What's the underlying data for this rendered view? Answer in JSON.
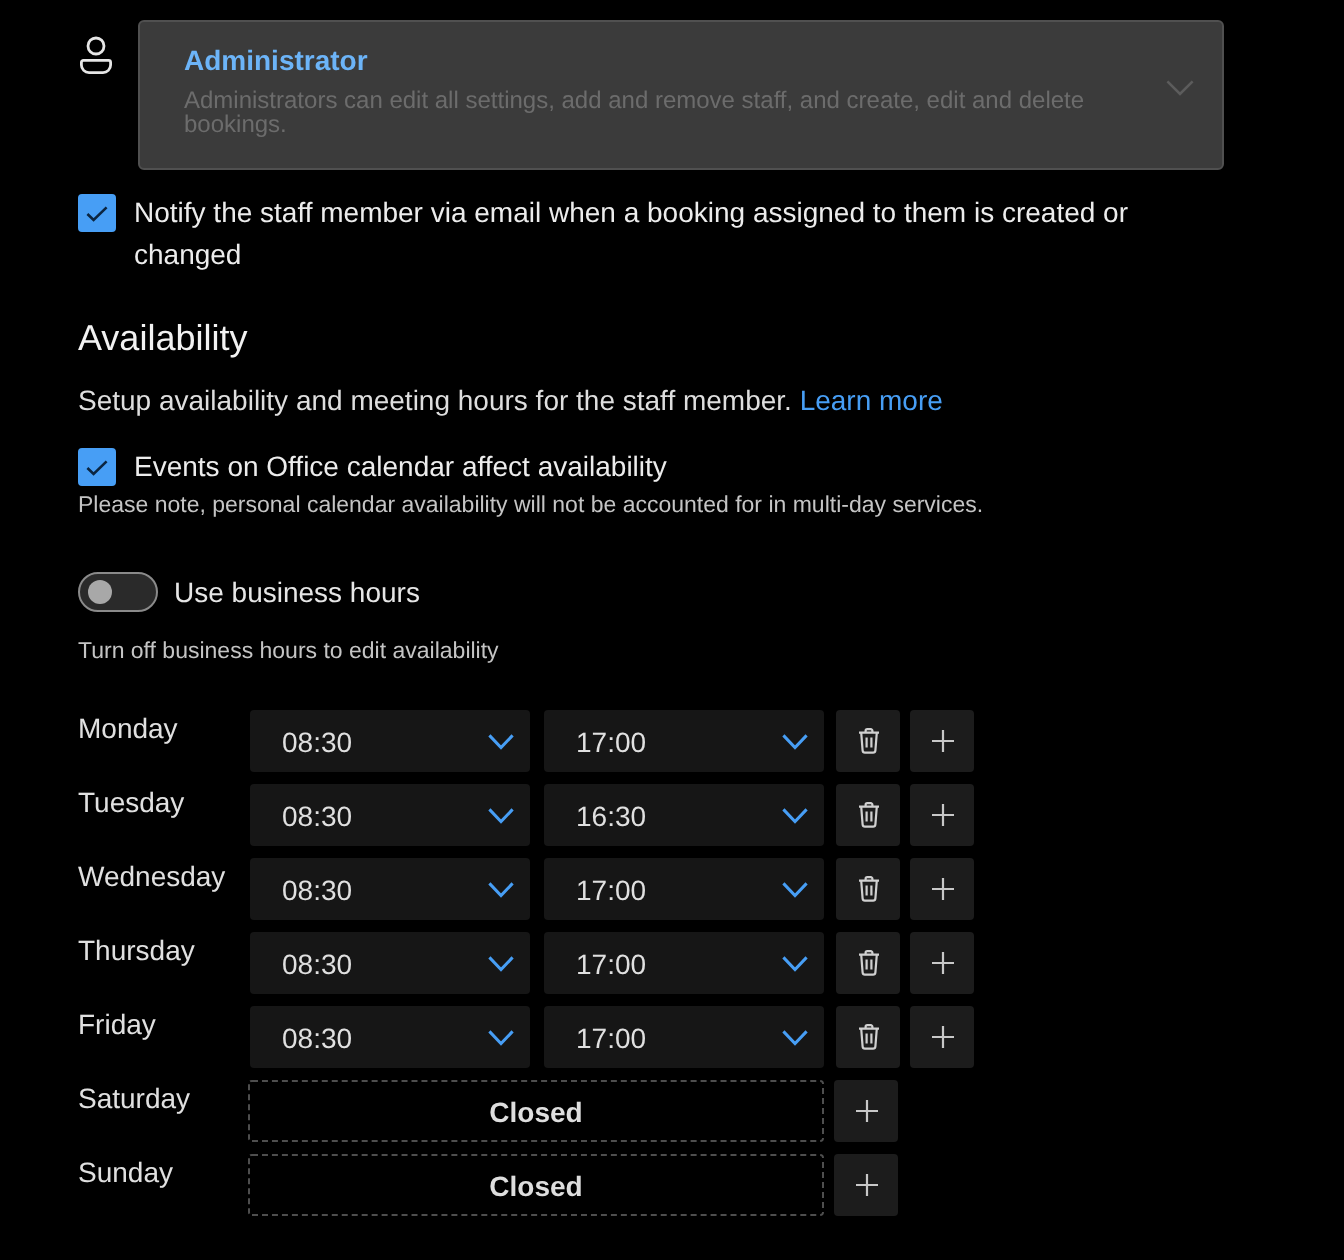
{
  "role": {
    "title": "Administrator",
    "description": "Administrators can edit all settings, add and remove staff, and create, edit and delete bookings.",
    "disabled": true
  },
  "notify": {
    "label": "Notify the staff member via email when a booking assigned to them is created or changed",
    "checked": true
  },
  "availability": {
    "heading": "Availability",
    "intro": "Setup availability and meeting hours for the staff member.",
    "link": "Learn more",
    "calendar_option": {
      "label": "Events on Office calendar affect availability",
      "checked": true
    },
    "note": "Please note, personal calendar availability will not be accounted for in multi-day services.",
    "business_hours": {
      "label": "Use business hours",
      "on": false
    },
    "hint": "Turn off business hours to edit availability"
  },
  "schedule": [
    {
      "day": "Monday",
      "kind": "hours",
      "start": "08:30",
      "end": "17:00"
    },
    {
      "day": "Tuesday",
      "kind": "hours",
      "start": "08:30",
      "end": "16:30"
    },
    {
      "day": "Wednesday",
      "kind": "hours",
      "start": "08:30",
      "end": "17:00"
    },
    {
      "day": "Thursday",
      "kind": "hours",
      "start": "08:30",
      "end": "17:00"
    },
    {
      "day": "Friday",
      "kind": "hours",
      "start": "08:30",
      "end": "17:00"
    },
    {
      "day": "Saturday",
      "kind": "closed",
      "status": "Closed"
    },
    {
      "day": "Sunday",
      "kind": "closed",
      "status": "Closed"
    }
  ]
}
